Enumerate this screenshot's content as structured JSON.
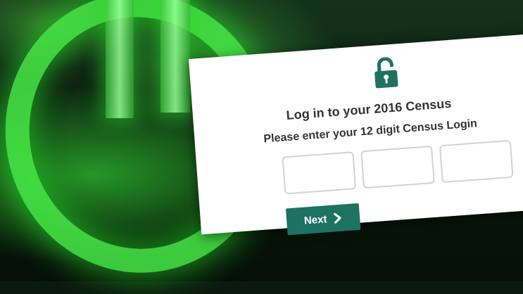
{
  "login": {
    "title": "Log in to your 2016 Census",
    "subtitle": "Please enter your 12 digit Census Login",
    "fields": [
      {
        "value": "",
        "placeholder": ""
      },
      {
        "value": "",
        "placeholder": ""
      },
      {
        "value": "",
        "placeholder": ""
      }
    ],
    "next_label": "Next",
    "lock_icon": "padlock-open-icon",
    "chevron_icon": "chevron-right-icon",
    "accent": "#1e7262"
  }
}
